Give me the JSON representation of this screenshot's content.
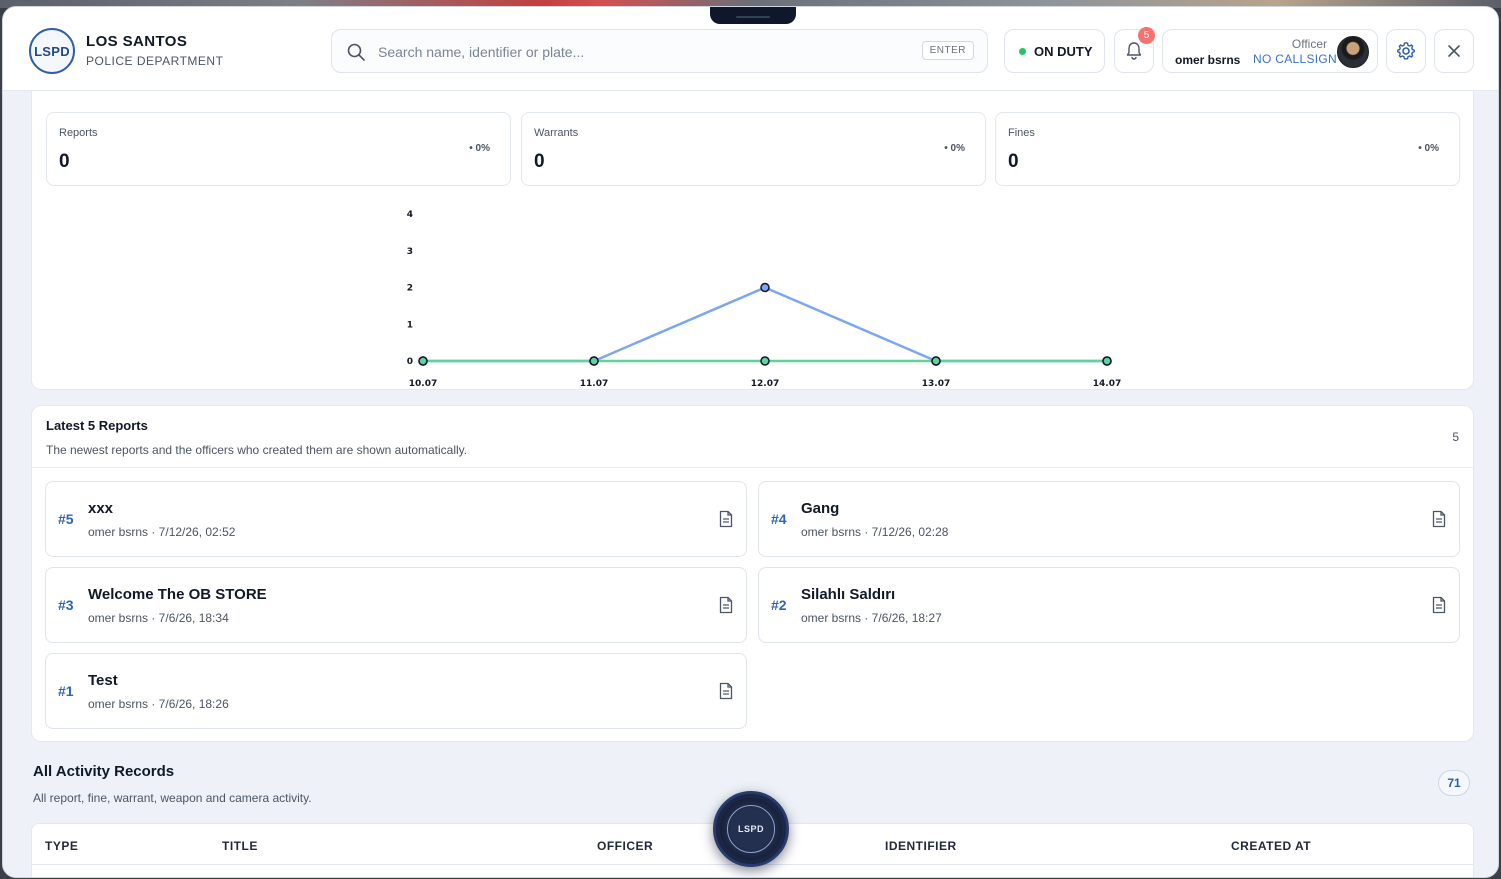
{
  "header": {
    "logo_text": "LSPD",
    "brand_title": "LOS SANTOS",
    "brand_subtitle": "POLICE DEPARTMENT",
    "search_placeholder": "Search name, identifier or plate...",
    "search_key": "ENTER",
    "duty_status": "ON DUTY",
    "notification_count": "5",
    "officer_role": "Officer",
    "officer_name": "omer bsrns",
    "officer_callsign": "NO CALLSIGN"
  },
  "stats": [
    {
      "label": "Reports",
      "value": "0",
      "change": "0%"
    },
    {
      "label": "Warrants",
      "value": "0",
      "change": "0%"
    },
    {
      "label": "Fines",
      "value": "0",
      "change": "0%"
    }
  ],
  "chart_data": {
    "type": "line",
    "x": [
      "10.07",
      "11.07",
      "12.07",
      "13.07",
      "14.07"
    ],
    "yticks": [
      "0",
      "1",
      "2",
      "3",
      "4"
    ],
    "ylim": [
      0,
      4
    ],
    "series": [
      {
        "color": "#7ba7f0",
        "values": [
          0,
          0,
          2,
          0,
          0
        ]
      },
      {
        "color": "#5fd39b",
        "values": [
          0,
          0,
          0,
          0,
          0
        ]
      }
    ],
    "grid": false
  },
  "reports": {
    "title": "Latest 5 Reports",
    "subtitle": "The newest reports and the officers who created them are shown automatically.",
    "count": "5",
    "items": [
      {
        "num": "#5",
        "title": "xxx",
        "meta": "omer bsrns · 7/12/26, 02:52"
      },
      {
        "num": "#4",
        "title": "Gang",
        "meta": "omer bsrns · 7/12/26, 02:28"
      },
      {
        "num": "#3",
        "title": "Welcome The OB STORE",
        "meta": "omer bsrns · 7/6/26, 18:34"
      },
      {
        "num": "#2",
        "title": "Silahlı Saldırı",
        "meta": "omer bsrns · 7/6/26, 18:27"
      },
      {
        "num": "#1",
        "title": "Test",
        "meta": "omer bsrns · 7/6/26, 18:26"
      }
    ]
  },
  "activity": {
    "title": "All Activity Records",
    "subtitle": "All report, fine, warrant, weapon and camera activity.",
    "count": "71",
    "columns": [
      "TYPE",
      "TITLE",
      "OFFICER",
      "IDENTIFIER",
      "CREATED AT"
    ]
  },
  "fab_label": "LSPD",
  "icons": {
    "search": "search-icon",
    "bell": "bell-icon",
    "gear": "gear-icon",
    "close": "close-icon",
    "report": "document-icon"
  }
}
